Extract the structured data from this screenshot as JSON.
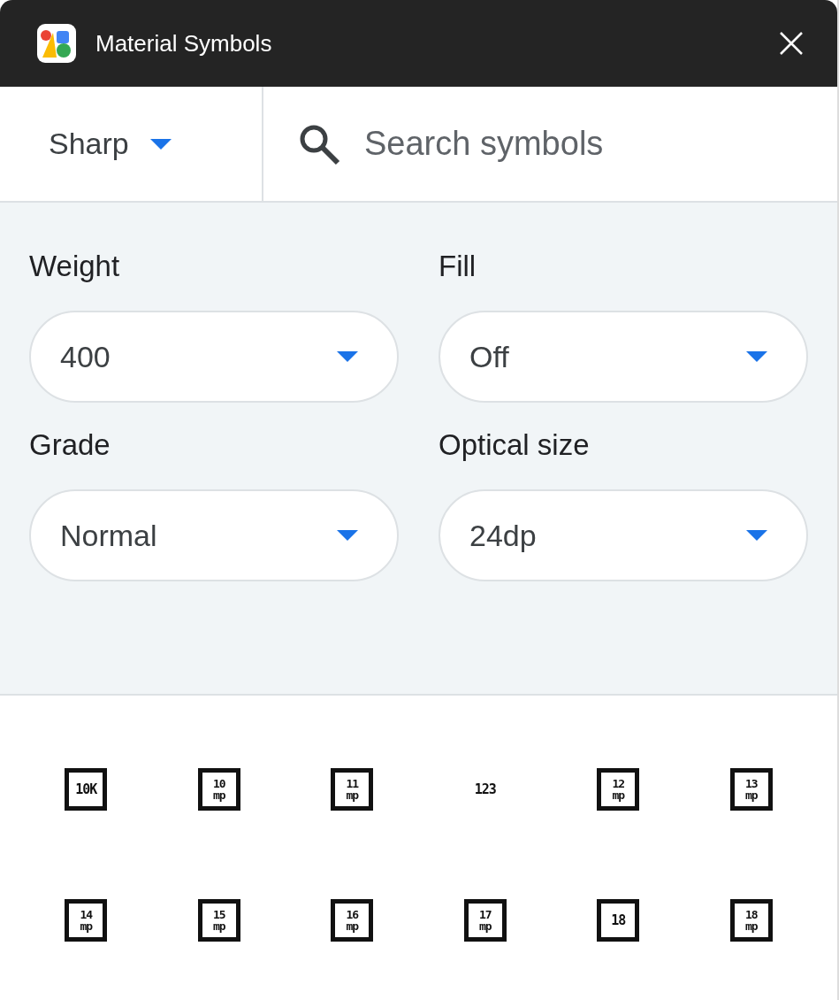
{
  "window": {
    "title": "Material Symbols"
  },
  "style_select": {
    "value": "Sharp"
  },
  "search": {
    "placeholder": "Search symbols"
  },
  "settings": [
    {
      "label": "Weight",
      "value": "400"
    },
    {
      "label": "Fill",
      "value": "Off"
    },
    {
      "label": "Grade",
      "value": "Normal"
    },
    {
      "label": "Optical size",
      "value": "24dp"
    }
  ],
  "symbols": [
    {
      "kind": "boxed",
      "lines": [
        "10K"
      ]
    },
    {
      "kind": "boxed",
      "lines": [
        "10",
        "mp"
      ]
    },
    {
      "kind": "boxed",
      "lines": [
        "11",
        "mp"
      ]
    },
    {
      "kind": "plain",
      "lines": [
        "123"
      ]
    },
    {
      "kind": "boxed",
      "lines": [
        "12",
        "mp"
      ]
    },
    {
      "kind": "boxed",
      "lines": [
        "13",
        "mp"
      ]
    },
    {
      "kind": "boxed",
      "lines": [
        "14",
        "mp"
      ]
    },
    {
      "kind": "boxed",
      "lines": [
        "15",
        "mp"
      ]
    },
    {
      "kind": "boxed",
      "lines": [
        "16",
        "mp"
      ]
    },
    {
      "kind": "boxed",
      "lines": [
        "17",
        "mp"
      ]
    },
    {
      "kind": "boxed",
      "lines": [
        "18"
      ]
    },
    {
      "kind": "boxed",
      "lines": [
        "18",
        "mp"
      ]
    }
  ]
}
